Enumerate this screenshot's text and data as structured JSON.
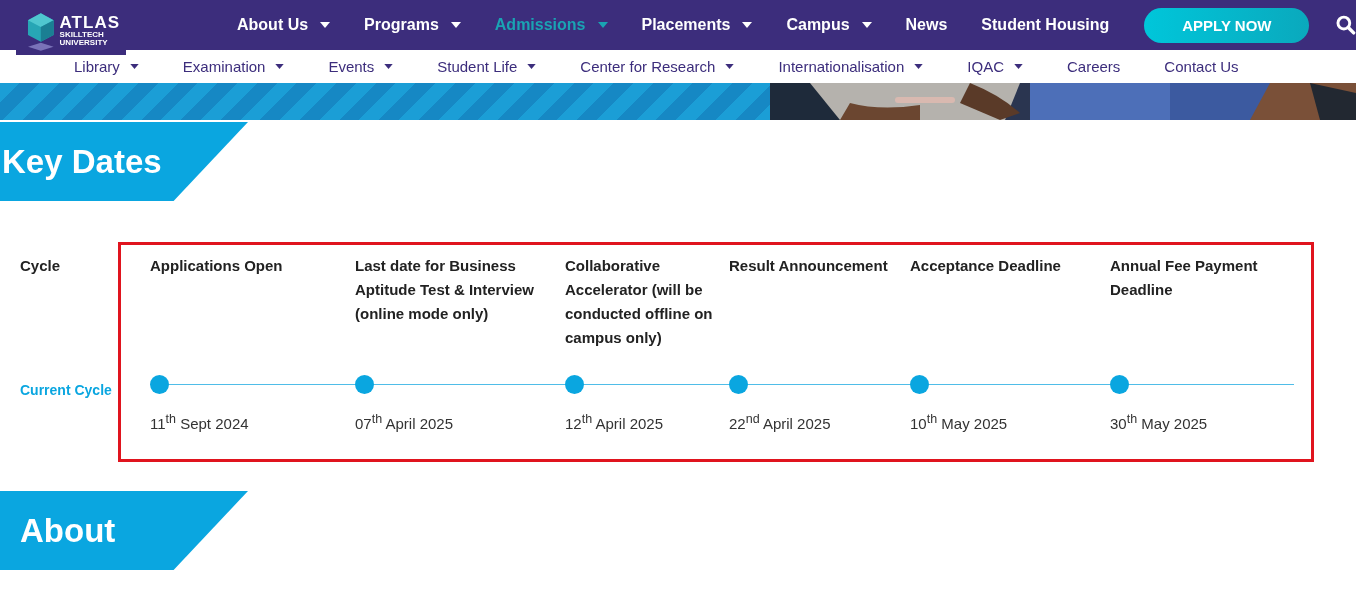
{
  "header": {
    "logo": {
      "wordmark": "ATLAS",
      "line_2": "SKILLTECH",
      "line_3": "UNIVERSITY"
    },
    "nav": [
      {
        "label": "About Us",
        "dropdown": true,
        "selected": false
      },
      {
        "label": "Programs",
        "dropdown": true,
        "selected": false
      },
      {
        "label": "Admissions",
        "dropdown": true,
        "selected": true
      },
      {
        "label": "Placements",
        "dropdown": true,
        "selected": false
      },
      {
        "label": "Campus",
        "dropdown": true,
        "selected": false
      },
      {
        "label": "News",
        "dropdown": false,
        "selected": false
      },
      {
        "label": "Student Housing",
        "dropdown": false,
        "selected": false
      }
    ],
    "cta": "APPLY NOW"
  },
  "subnav": [
    {
      "label": "Library",
      "dropdown": true
    },
    {
      "label": "Examination",
      "dropdown": true
    },
    {
      "label": "Events",
      "dropdown": true
    },
    {
      "label": "Student Life",
      "dropdown": true
    },
    {
      "label": "Center for Research",
      "dropdown": true
    },
    {
      "label": "Internationalisation",
      "dropdown": true
    },
    {
      "label": "IQAC",
      "dropdown": true
    },
    {
      "label": "Careers",
      "dropdown": false
    },
    {
      "label": "Contact Us",
      "dropdown": false
    }
  ],
  "key_dates": {
    "title": "Key Dates",
    "column_label": "Cycle",
    "row_label": "Current Cycle",
    "milestones": [
      {
        "title": "Applications Open",
        "date": "11$^{th}$ Sept 2024"
      },
      {
        "title": "Last date for Business Aptitude Test & Interview (online mode only)",
        "date": "07$^{th}$ April 2025"
      },
      {
        "title": "Collaborative Accelerator (will be conducted offline on campus only)",
        "date": "12$^{th}$ April 2025"
      },
      {
        "title": "Result Announcement",
        "date": "22$^{nd}$ April 2025"
      },
      {
        "title": "Acceptance Deadline",
        "date": "10$^{th}$ May 2025"
      },
      {
        "title": "Annual Fee Payment Deadline",
        "date": "30$^{th}$ May 2025"
      }
    ]
  },
  "about": {
    "title": "About"
  }
}
